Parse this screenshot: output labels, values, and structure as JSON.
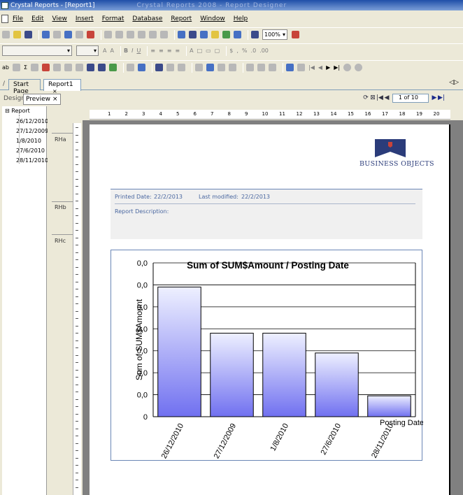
{
  "window": {
    "title": "Crystal Reports - [Report1]",
    "title_blurred": "Crystal Reports 2008 - Report Designer"
  },
  "menu": [
    "File",
    "Edit",
    "View",
    "Insert",
    "Format",
    "Database",
    "Report",
    "Window",
    "Help"
  ],
  "toolbar": {
    "zoom": "100%"
  },
  "tabs": [
    {
      "label": "Start Page"
    },
    {
      "label": "Report1"
    }
  ],
  "subtabs": {
    "design": "Design",
    "preview": "Preview"
  },
  "navigator": {
    "page_display": "1 of 10"
  },
  "tree": {
    "root": "Report",
    "items": [
      "26/12/2010",
      "27/12/2009",
      "1/8/2010",
      "27/6/2010",
      "28/11/2010"
    ]
  },
  "sections": [
    "RHa",
    "RHb",
    "RHc"
  ],
  "ruler": {
    "numbers": [
      "1",
      "2",
      "3",
      "4",
      "5",
      "6",
      "7",
      "8",
      "9",
      "10",
      "11",
      "12",
      "13",
      "14",
      "15",
      "16",
      "17",
      "18",
      "19",
      "20"
    ]
  },
  "logo": {
    "text": "BUSINESS OBJECTS"
  },
  "report_header": {
    "printed_date_label": "Printed Date:",
    "printed_date_value": "22/2/2013",
    "last_modified_label": "Last modified:",
    "last_modified_value": "22/2/2013",
    "description_label": "Report Description:"
  },
  "chart_data": {
    "type": "bar",
    "title": "Sum of SUM$Amount / Posting Date",
    "xlabel": "Posting Date",
    "ylabel": "Sum of SUM$Amount",
    "y_tick_labels": [
      "0",
      "0,0",
      "0,0",
      "0,0",
      "0,0",
      "0,0",
      "0,0",
      "0,0"
    ],
    "ylim": [
      0,
      7
    ],
    "grid": true,
    "categories": [
      "26/12/2010",
      "27/12/2009",
      "1/8/2010",
      "27/6/2010",
      "28/11/2010"
    ],
    "values": [
      5.9,
      3.8,
      3.8,
      2.9,
      0.95
    ],
    "bar_color_top": "#eef0ff",
    "bar_color_bottom": "#7070f0"
  }
}
